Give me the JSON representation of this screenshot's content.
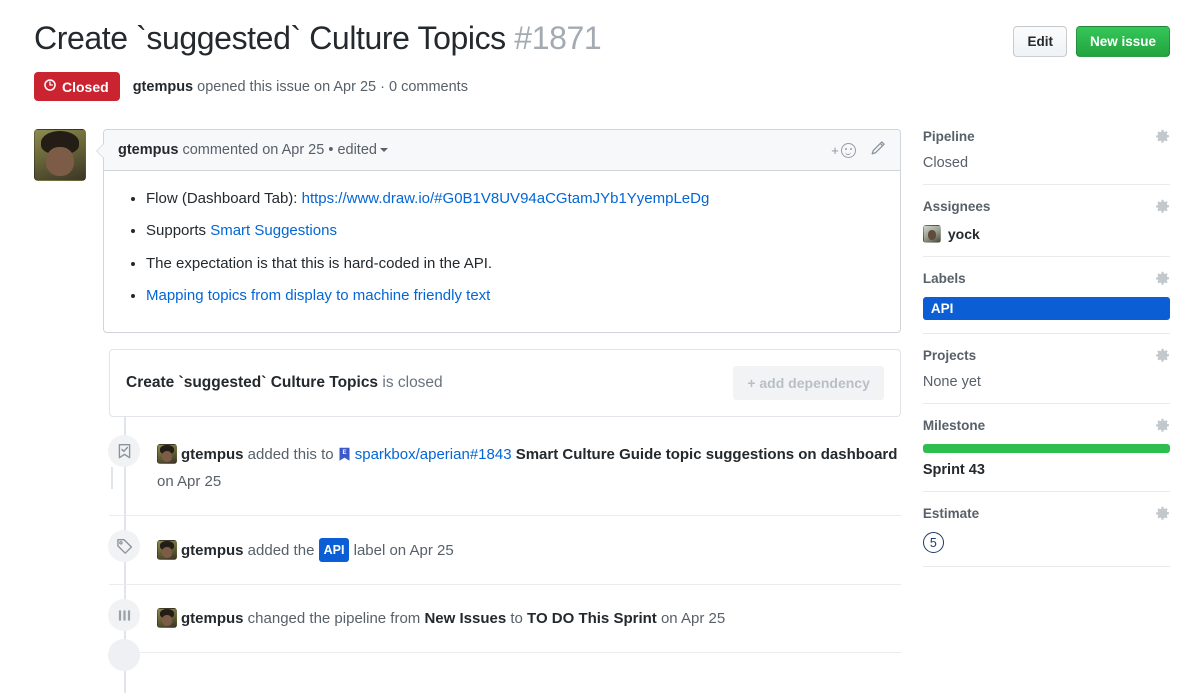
{
  "header": {
    "title_text": "Create `suggested` Culture Topics",
    "issue_number": "#1871",
    "edit_label": "Edit",
    "new_issue_label": "New issue",
    "state_label": "Closed",
    "meta_author": "gtempus",
    "meta_rest": " opened this issue on Apr 25 · 0 comments"
  },
  "comment": {
    "author": "gtempus",
    "meta": " commented on Apr 25 • ",
    "edited_label": "edited",
    "bullets": {
      "b1_prefix": "Flow (Dashboard Tab): ",
      "b1_link": "https://www.draw.io/#G0B1V8UV94aCGtamJYb1YyempLeDg",
      "b2_prefix": "Supports ",
      "b2_link": "Smart Suggestions",
      "b3_text": "The expectation is that this is hard-coded in the API.",
      "b4_link": "Mapping topics from display to machine friendly text"
    }
  },
  "dependency": {
    "title": "Create `suggested` Culture Topics",
    "status_suffix": " is closed",
    "add_label": "+ add dependency"
  },
  "timeline": [
    {
      "icon": "bookmark-check-icon",
      "author": "gtempus",
      "action": " added this to ",
      "link": "sparkbox/aperian#1843",
      "bold_text": "Smart Culture Guide topic suggestions on dashboard",
      "suffix": " on Apr 25"
    },
    {
      "icon": "tag-icon",
      "author": "gtempus",
      "action": " added the ",
      "label": "API",
      "suffix": " label on Apr 25"
    },
    {
      "icon": "columns-icon",
      "author": "gtempus",
      "action": " changed the pipeline from ",
      "from_value": "New Issues",
      "middle": " to ",
      "to_value": "TO DO This Sprint",
      "suffix": " on Apr 25"
    }
  ],
  "sidebar": {
    "pipeline": {
      "title": "Pipeline",
      "value": "Closed"
    },
    "assignees": {
      "title": "Assignees",
      "value": "yock"
    },
    "labels": {
      "title": "Labels",
      "value": "API"
    },
    "projects": {
      "title": "Projects",
      "value": "None yet"
    },
    "milestone": {
      "title": "Milestone",
      "value": "Sprint 43"
    },
    "estimate": {
      "title": "Estimate",
      "value": "5"
    }
  },
  "colors": {
    "closed_red": "#cb2431",
    "green": "#2cbe4e",
    "label_blue": "#0b5ed4",
    "link_blue": "#0366d6"
  }
}
